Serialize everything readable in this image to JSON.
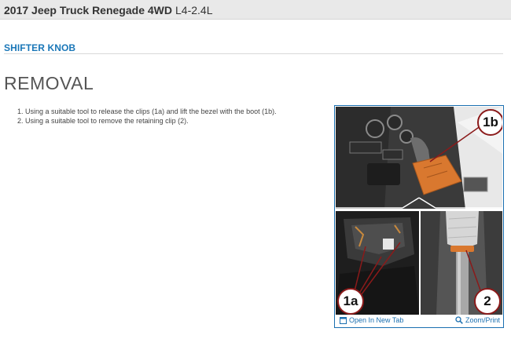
{
  "header": {
    "vehicle": "2017 Jeep Truck Renegade 4WD",
    "engine": "L4-2.4L"
  },
  "section": {
    "title": "SHIFTER KNOB"
  },
  "procedure": {
    "heading": "REMOVAL",
    "steps": [
      "Using a suitable tool to release the clips (1a) and lift the bezel with the boot (1b).",
      "Using a suitable tool to remove the retaining clip (2)."
    ]
  },
  "figure": {
    "callouts": {
      "top": "1b",
      "bottom_left": "1a",
      "bottom_right": "2"
    },
    "open_label": "Open In New Tab",
    "zoom_label": "Zoom/Print",
    "icons": {
      "open": "open-in-new-tab-icon",
      "zoom": "magnifier-icon"
    },
    "colors": {
      "link": "#1a6fb0",
      "callout_border": "#8b1a1a",
      "bezel": "#d9782f"
    }
  }
}
